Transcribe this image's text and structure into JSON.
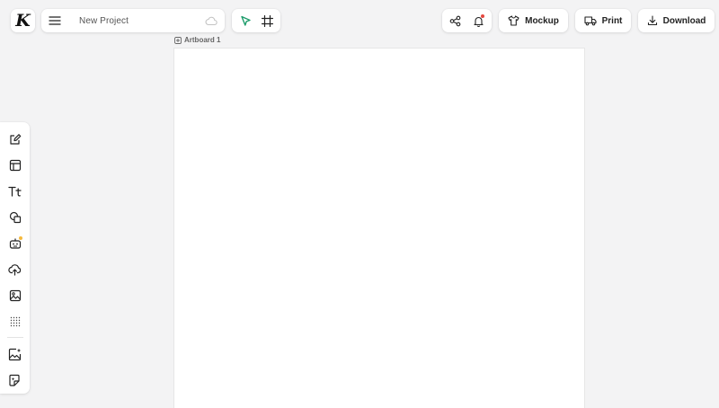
{
  "logo": {
    "letter": "K"
  },
  "project": {
    "name": "New Project"
  },
  "header": {
    "mockup_label": "Mockup",
    "print_label": "Print",
    "download_label": "Download"
  },
  "artboard": {
    "label": "Artboard 1"
  },
  "icons": {
    "menu": "hamburger-menu-icon",
    "cloud": "cloud-icon",
    "select": "cursor-select-icon",
    "frame": "frame-crop-icon",
    "share": "share-icon",
    "bell": "bell-icon",
    "tshirt": "tshirt-icon",
    "truck": "truck-icon",
    "download": "download-icon"
  },
  "sidebar": {
    "items": [
      {
        "name": "edit",
        "icon": "pencil-square-icon"
      },
      {
        "name": "templates",
        "icon": "layout-icon"
      },
      {
        "name": "text",
        "icon": "text-icon"
      },
      {
        "name": "shapes",
        "icon": "shapes-icon"
      },
      {
        "name": "ai-assistant",
        "icon": "robot-icon",
        "badge": true
      },
      {
        "name": "uploads",
        "icon": "upload-cloud-icon"
      },
      {
        "name": "photos",
        "icon": "image-icon"
      },
      {
        "name": "patterns",
        "icon": "dot-grid-icon"
      },
      {
        "name": "image-generator",
        "icon": "image-sparkle-icon"
      },
      {
        "name": "sticker-generator",
        "icon": "sticker-sparkle-icon"
      }
    ]
  },
  "colors": {
    "background": "#f3f3f4",
    "surface": "#ffffff",
    "accent_green": "#1d9c6b",
    "notify_red": "#e5483f",
    "badge_yellow": "#f5b93d"
  }
}
